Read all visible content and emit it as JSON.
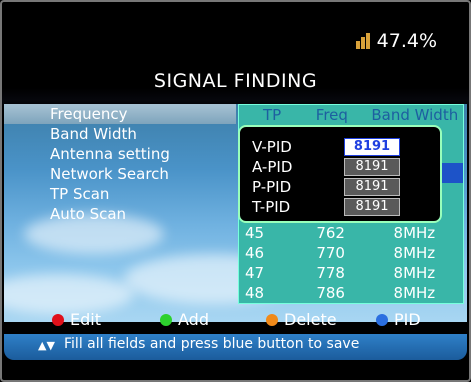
{
  "signal": {
    "value": "47.4%"
  },
  "title": "SIGNAL FINDING",
  "menu": [
    {
      "label": "Frequency",
      "selected": true
    },
    {
      "label": "Band Width",
      "selected": false
    },
    {
      "label": "Antenna setting",
      "selected": false
    },
    {
      "label": "Network Search",
      "selected": false
    },
    {
      "label": "TP Scan",
      "selected": false
    },
    {
      "label": "Auto Scan",
      "selected": false
    }
  ],
  "table": {
    "headers": [
      "TP",
      "Freq",
      "Band Width"
    ],
    "rows": [
      [
        "45",
        "762",
        "8MHz"
      ],
      [
        "46",
        "770",
        "8MHz"
      ],
      [
        "47",
        "778",
        "8MHz"
      ],
      [
        "48",
        "786",
        "8MHz"
      ]
    ]
  },
  "pid": [
    {
      "label": "V-PID",
      "value": "8191",
      "active": true
    },
    {
      "label": "A-PID",
      "value": "8191",
      "active": false
    },
    {
      "label": "P-PID",
      "value": "8191",
      "active": false
    },
    {
      "label": "T-PID",
      "value": "8191",
      "active": false
    }
  ],
  "legend": {
    "edit": "Edit",
    "add": "Add",
    "delete": "Delete",
    "pid": "PID"
  },
  "colors": {
    "red": "#e0101a",
    "green": "#2dd12d",
    "orange": "#f08a1a",
    "blue": "#2b6fe0"
  },
  "hint": "Fill all fields and press blue button to save"
}
